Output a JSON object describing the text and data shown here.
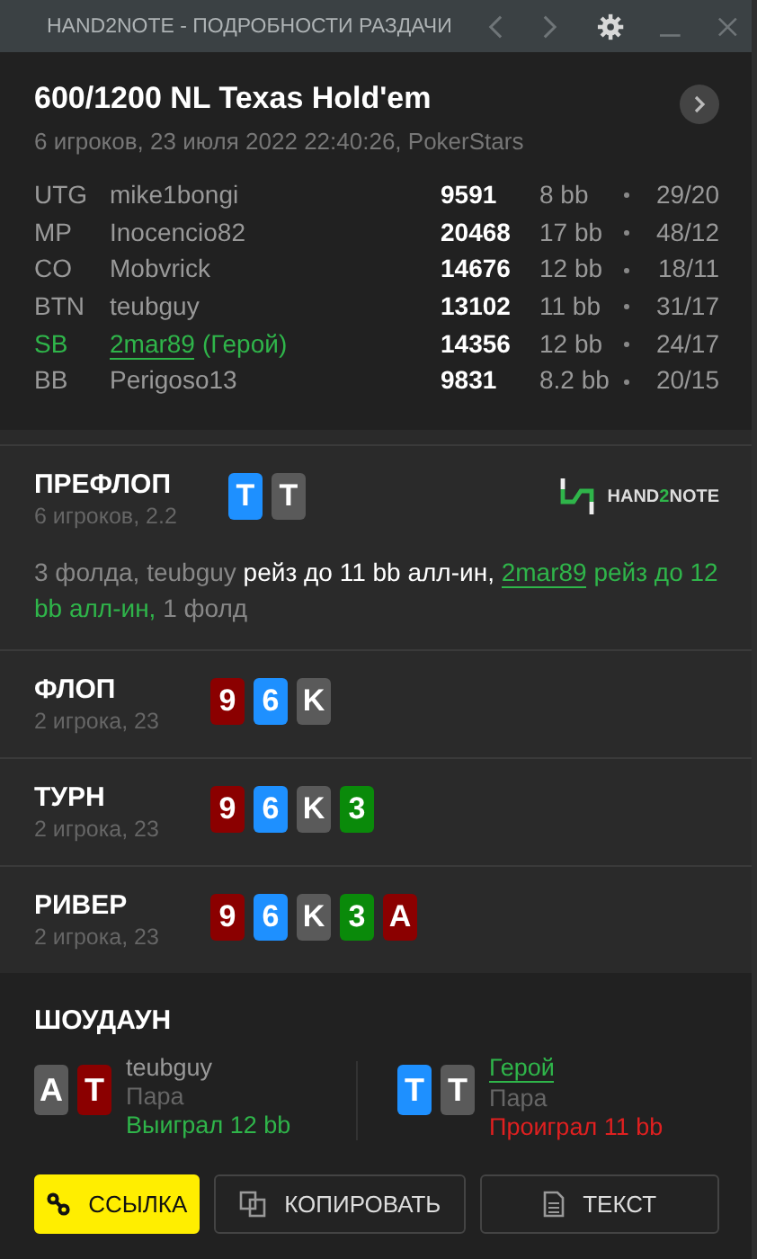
{
  "window": {
    "title": "HAND2NOTE - ПОДРОБНОСТИ РАЗДАЧИ",
    "back_disabled": true,
    "forward_disabled": true
  },
  "hand": {
    "title": "600/1200 NL Texas Hold'em",
    "subtitle": "6 игроков, 23 июля 2022 22:40:26, PokerStars"
  },
  "players": [
    {
      "position": "UTG",
      "name": "mike1bongi",
      "hero": false,
      "stack": "9591",
      "bb": "8 bb",
      "stats": "29/20"
    },
    {
      "position": "MP",
      "name": "Inocencio82",
      "hero": false,
      "stack": "20468",
      "bb": "17 bb",
      "stats": "48/12"
    },
    {
      "position": "CO",
      "name": "Mobvrick",
      "hero": false,
      "stack": "14676",
      "bb": "12 bb",
      "stats": "18/11"
    },
    {
      "position": "BTN",
      "name": "teubguy",
      "hero": false,
      "stack": "13102",
      "bb": "11 bb",
      "stats": "31/17"
    },
    {
      "position": "SB",
      "name": "2mar89",
      "hero": true,
      "hero_tag": "(Герой)",
      "stack": "14356",
      "bb": "12 bb",
      "stats": "24/17"
    },
    {
      "position": "BB",
      "name": "Perigoso13",
      "hero": false,
      "stack": "9831",
      "bb": "8.2 bb",
      "stats": "20/15"
    }
  ],
  "logo": {
    "prefix": "HAND",
    "accent": "2",
    "suffix": "NOTE"
  },
  "streets": [
    {
      "name": "ПРЕФЛОП",
      "info": "6 игроков, 2.2",
      "cards": [
        {
          "rank": "T",
          "color": "#1e90ff"
        },
        {
          "rank": "T",
          "color": "#5a5a5a"
        }
      ],
      "actions": [
        {
          "kind": "plain",
          "text": "3 фолда, teubguy "
        },
        {
          "kind": "action",
          "text": "рейз до 11 bb алл-ин, "
        },
        {
          "kind": "hero-link",
          "text": "2mar89"
        },
        {
          "kind": "hero",
          "text": " рейз до 12 bb алл-ин,"
        },
        {
          "kind": "plain",
          "text": " 1 фолд"
        }
      ]
    },
    {
      "name": "ФЛОП",
      "info": "2 игрока, 23",
      "cards": [
        {
          "rank": "9",
          "color": "#8b0000"
        },
        {
          "rank": "6",
          "color": "#1e90ff"
        },
        {
          "rank": "K",
          "color": "#5a5a5a"
        }
      ]
    },
    {
      "name": "ТУРН",
      "info": "2 игрока, 23",
      "cards": [
        {
          "rank": "9",
          "color": "#8b0000"
        },
        {
          "rank": "6",
          "color": "#1e90ff"
        },
        {
          "rank": "K",
          "color": "#5a5a5a"
        },
        {
          "rank": "3",
          "color": "#0a8a0a"
        }
      ]
    },
    {
      "name": "РИВЕР",
      "info": "2 игрока, 23",
      "cards": [
        {
          "rank": "9",
          "color": "#8b0000"
        },
        {
          "rank": "6",
          "color": "#1e90ff"
        },
        {
          "rank": "K",
          "color": "#5a5a5a"
        },
        {
          "rank": "3",
          "color": "#0a8a0a"
        },
        {
          "rank": "A",
          "color": "#8b0000"
        }
      ]
    }
  ],
  "showdown": {
    "title": "ШОУДАУН",
    "hands": [
      {
        "player": "teubguy",
        "hero": false,
        "combo": "Пара",
        "result": "Выиграл 12 bb",
        "won": true,
        "cards": [
          {
            "rank": "A",
            "color": "#5a5a5a"
          },
          {
            "rank": "T",
            "color": "#8b0000"
          }
        ]
      },
      {
        "player": "Герой",
        "hero": true,
        "combo": "Пара",
        "result": "Проиграл 11 bb",
        "won": false,
        "cards": [
          {
            "rank": "T",
            "color": "#1e90ff"
          },
          {
            "rank": "T",
            "color": "#5a5a5a"
          }
        ]
      }
    ]
  },
  "buttons": [
    {
      "kind": "link",
      "label": "ССЫЛКА",
      "primary": true
    },
    {
      "kind": "copy",
      "label": "КОПИРОВАТЬ",
      "primary": false
    },
    {
      "kind": "text",
      "label": "ТЕКСТ",
      "primary": false
    }
  ]
}
